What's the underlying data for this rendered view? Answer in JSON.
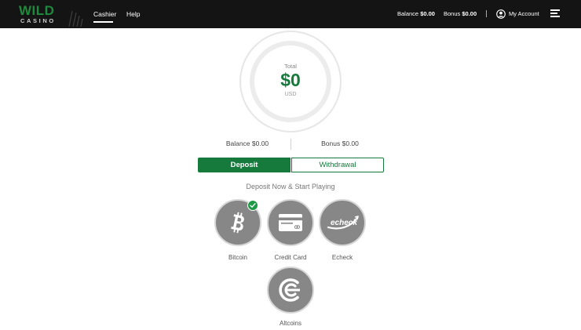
{
  "brand": {
    "logo_main": "WILD",
    "logo_sub": "CASINO"
  },
  "nav": {
    "cashier": "Cashier",
    "help": "Help"
  },
  "header": {
    "balance_label": "Balance",
    "balance_value": "$0.00",
    "bonus_label": "Bonus",
    "bonus_value": "$0.00",
    "account": "My Account"
  },
  "total": {
    "label": "Total",
    "amount": "$0",
    "currency": "USD"
  },
  "summary": {
    "balance": "Balance $0.00",
    "bonus": "Bonus $0.00"
  },
  "tabs": {
    "deposit": "Deposit",
    "withdrawal": "Withdrawal",
    "active": "deposit"
  },
  "subtitle": "Deposit Now & Start Playing",
  "methods": [
    {
      "label": "Bitcoin",
      "icon": "bitcoin-icon",
      "selected": true
    },
    {
      "label": "Credit Card",
      "icon": "credit-card-icon",
      "selected": false
    },
    {
      "label": "Echeck",
      "icon": "echeck-icon",
      "icon_text": "echeck",
      "selected": false
    },
    {
      "label": "Altcoins",
      "icon": "altcoins-icon",
      "selected": false
    }
  ],
  "colors": {
    "brand_green": "#157a3c",
    "topbar": "#141414",
    "method_gray": "#878787",
    "check_green": "#1e9a45"
  }
}
